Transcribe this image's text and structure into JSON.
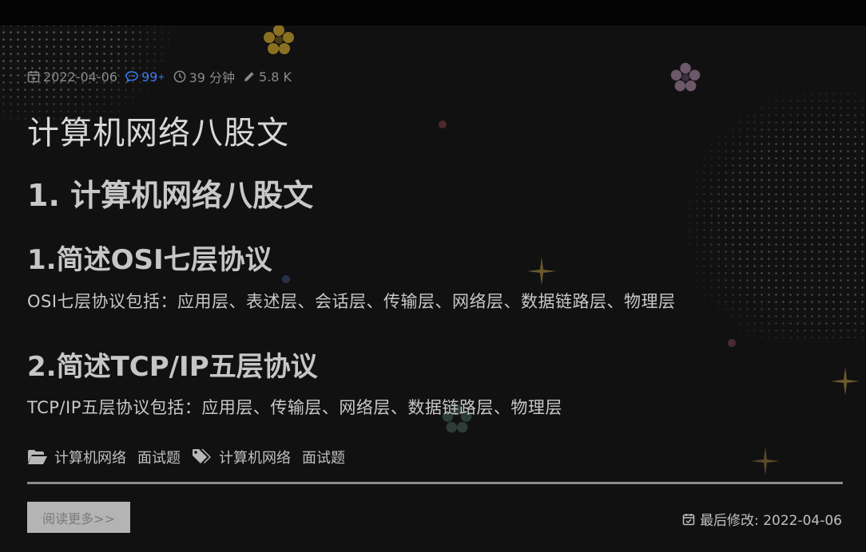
{
  "post": {
    "meta": {
      "date": "2022-04-06",
      "comments": "99",
      "comments_suffix": "+",
      "read_time": "39 分钟",
      "words": "5.8 K"
    },
    "title": "计算机网络八股文",
    "heading1": "1. 计算机网络八股文",
    "sections": [
      {
        "heading": "1.简述OSI七层协议",
        "text": "OSI七层协议包括：应用层、表述层、会话层、传输层、网络层、数据链路层、物理层"
      },
      {
        "heading": "2.简述TCP/IP五层协议",
        "text": "TCP/IP五层协议包括：应用层、传输层、网络层、数据链路层、物理层"
      }
    ],
    "categories": [
      "计算机网络",
      "面试题"
    ],
    "tags": [
      "计算机网络",
      "面试题"
    ],
    "read_more": "阅读更多>>",
    "last_modified_label": "最后修改: 2022-04-06"
  },
  "icons": {
    "date": "calendar-plus-icon",
    "comments": "comment-icon",
    "time": "clock-icon",
    "words": "pencil-icon",
    "category": "folder-open-icon",
    "tag": "tags-icon",
    "modified": "calendar-check-icon"
  },
  "colors": {
    "background": "#111112",
    "accent_comments": "#3d7cf0",
    "button_bg": "#b4b4b4"
  }
}
